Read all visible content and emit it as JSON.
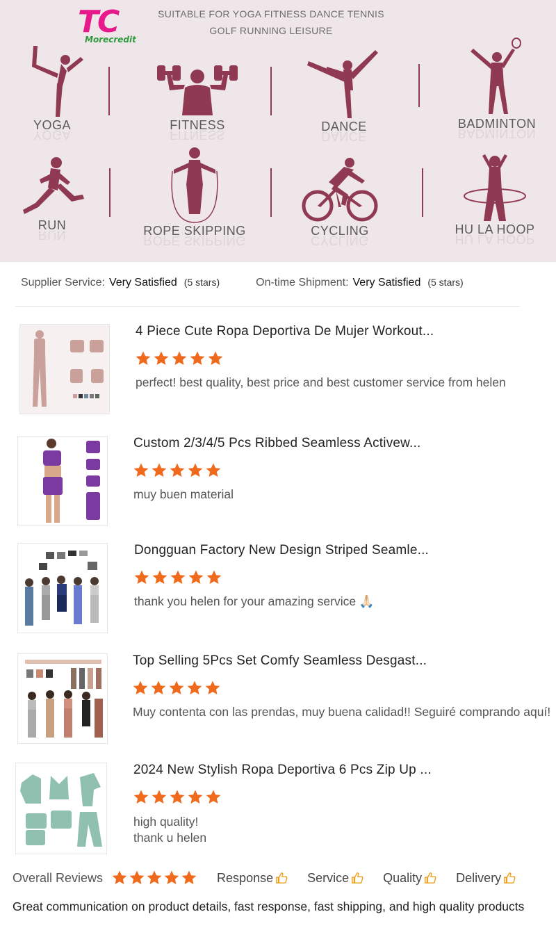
{
  "banner": {
    "logo_text": "TC",
    "logo_sub": "Morecredit",
    "tagline_line1": "SUITABLE FOR YOGA FITNESS DANCE TENNIS",
    "tagline_line2": "GOLF RUNNING LEISURE",
    "figure_color": "#8f3a52",
    "activities": [
      {
        "label": "YOGA",
        "icon": "yoga-icon"
      },
      {
        "label": "FITNESS",
        "icon": "fitness-icon"
      },
      {
        "label": "DANCE",
        "icon": "dance-icon"
      },
      {
        "label": "BADMINTON",
        "icon": "badminton-icon"
      },
      {
        "label": "RUN",
        "icon": "run-icon"
      },
      {
        "label": "ROPE SKIPPING",
        "icon": "rope-skipping-icon"
      },
      {
        "label": "CYCLING",
        "icon": "cycling-icon"
      },
      {
        "label": "HU LA HOOP",
        "icon": "hula-hoop-icon"
      }
    ]
  },
  "summary": {
    "supplier_label": "Supplier Service:",
    "supplier_value": "Very Satisfied",
    "supplier_stars": "(5 stars)",
    "shipment_label": "On-time Shipment:",
    "shipment_value": "Very Satisfied",
    "shipment_stars": "(5 stars)"
  },
  "reviews": [
    {
      "title": "4 Piece Cute Ropa Deportiva De Mujer Workout...",
      "rating": 5,
      "text": "perfect! best quality, best price and best customer service from helen",
      "text2": ""
    },
    {
      "title": "Custom 2/3/4/5 Pcs Ribbed Seamless Activew...",
      "rating": 5,
      "text": "muy buen material",
      "text2": ""
    },
    {
      "title": "Dongguan Factory New Design Striped Seamle...",
      "rating": 5,
      "text": "thank you helen for your amazing service 🙏🏻",
      "text2": ""
    },
    {
      "title": "Top Selling 5Pcs Set Comfy Seamless Desgast...",
      "rating": 5,
      "text": "Muy contenta con las prendas, muy buena calidad!! Seguiré comprando aquí!",
      "text2": ""
    },
    {
      "title": "2024 New Stylish Ropa Deportiva 6 Pcs Zip Up ...",
      "rating": 5,
      "text": "high quality!",
      "text2": "thank u helen"
    }
  ],
  "overall": {
    "label": "Overall Reviews",
    "rating": 5,
    "metrics": [
      "Response",
      "Service",
      "Quality",
      "Delivery"
    ]
  },
  "final_note": "Great communication on product details, fast response, fast shipping, and high quality products",
  "colors": {
    "star": "#ef6a1c",
    "thumb_icon": "#f0a020",
    "banner_bg": "#efe6e9",
    "figure": "#8f3a52"
  }
}
